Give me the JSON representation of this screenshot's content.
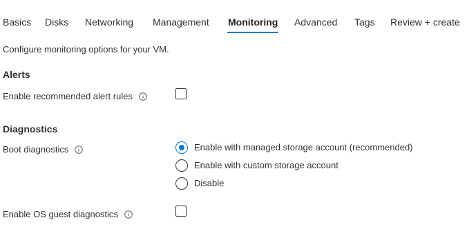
{
  "tabs": [
    {
      "label": "Basics"
    },
    {
      "label": "Disks"
    },
    {
      "label": "Networking"
    },
    {
      "label": "Management"
    },
    {
      "label": "Monitoring",
      "active": true
    },
    {
      "label": "Advanced"
    },
    {
      "label": "Tags"
    },
    {
      "label": "Review + create"
    }
  ],
  "intro": "Configure monitoring options for your VM.",
  "alerts": {
    "title": "Alerts",
    "recommended_label": "Enable recommended alert rules",
    "recommended_checked": false
  },
  "diagnostics": {
    "title": "Diagnostics",
    "boot_label": "Boot diagnostics",
    "boot_options": [
      {
        "label": "Enable with managed storage account (recommended)",
        "selected": true
      },
      {
        "label": "Enable with custom storage account",
        "selected": false
      },
      {
        "label": "Disable",
        "selected": false
      }
    ],
    "os_guest_label": "Enable OS guest diagnostics",
    "os_guest_checked": false
  },
  "colors": {
    "accent": "#0078d4",
    "text": "#323130"
  },
  "icons": {
    "info": "info-circle-icon"
  }
}
